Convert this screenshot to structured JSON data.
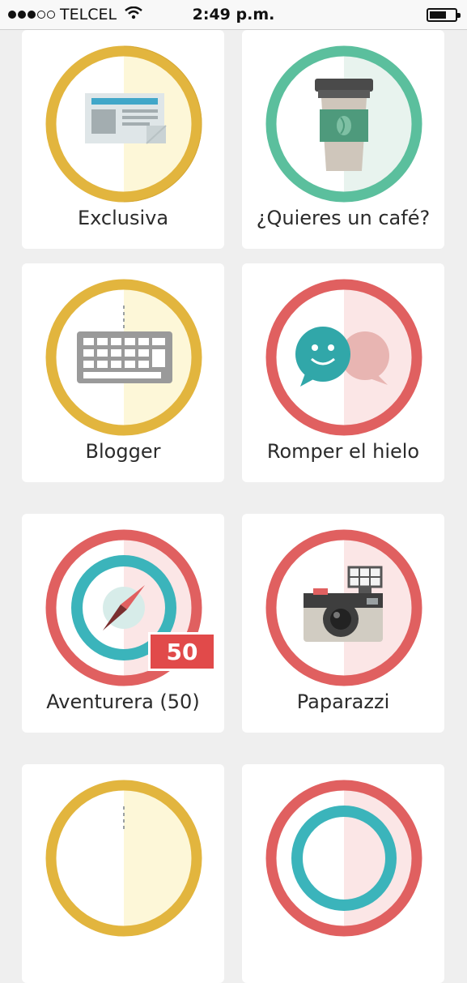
{
  "status_bar": {
    "carrier": "TELCEL",
    "time": "2:49 p.m."
  },
  "badges": [
    {
      "label": "Exclusiva",
      "ring_color": "#e2b53e",
      "fill_color": "#fdf7d8",
      "icon": "newspaper-icon"
    },
    {
      "label": "¿Quieres un café?",
      "ring_color": "#5bbf9d",
      "fill_color": "#e8f3ee",
      "icon": "coffee-cup-icon"
    },
    {
      "label": "Blogger",
      "ring_color": "#e2b53e",
      "fill_color": "#fdf7d8",
      "icon": "keyboard-icon"
    },
    {
      "label": "Romper el hielo",
      "ring_color": "#e06060",
      "fill_color": "#fbe6e6",
      "icon": "chat-bubbles-icon"
    },
    {
      "label": "Aventurera (50)",
      "ring_color": "#e06060",
      "fill_color": "#fbe6e6",
      "icon": "compass-icon",
      "count": "50"
    },
    {
      "label": "Paparazzi",
      "ring_color": "#e06060",
      "fill_color": "#fbe6e6",
      "icon": "camera-icon"
    },
    {
      "label": "",
      "ring_color": "#e2b53e",
      "fill_color": "#fdf7d8",
      "icon": "keyboard-icon"
    },
    {
      "label": "",
      "ring_color": "#e06060",
      "fill_color": "#fbe6e6",
      "icon": "compass-icon"
    }
  ]
}
